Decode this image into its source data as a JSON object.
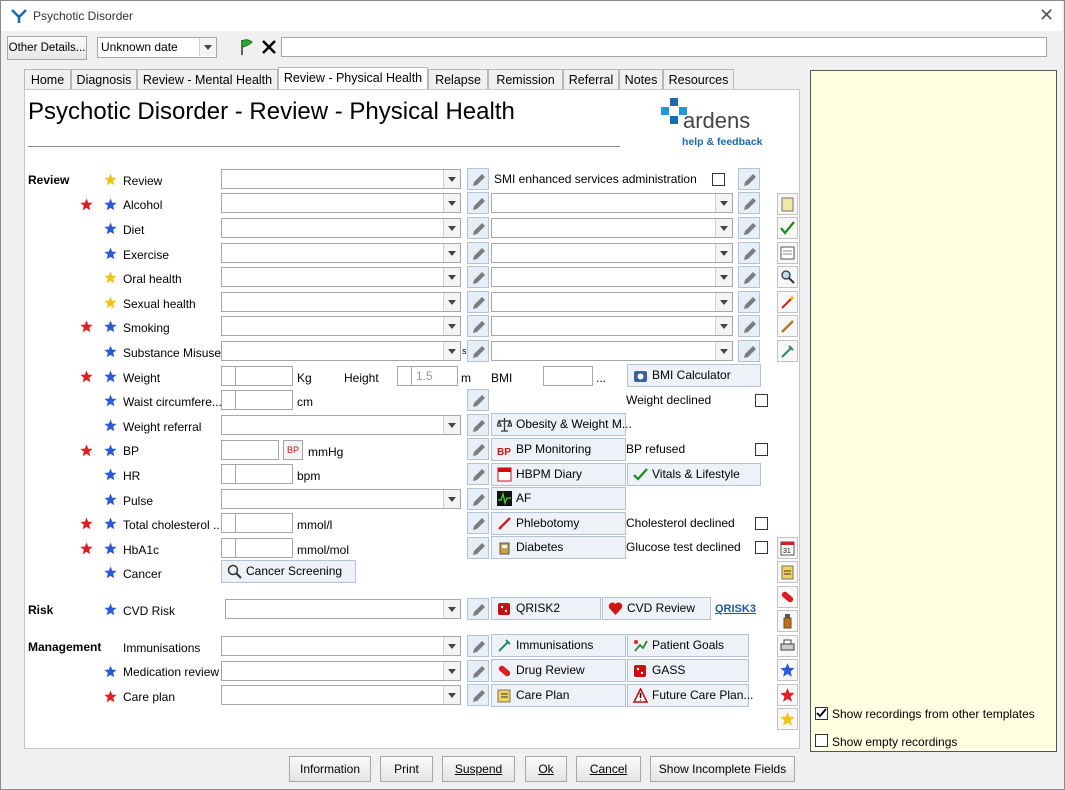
{
  "window": {
    "title": "Psychotic Disorder",
    "close": "✕"
  },
  "toolbar": {
    "other_details": "Other Details...",
    "date_value": "Unknown date",
    "text_value": ""
  },
  "tabs": [
    "Home",
    "Diagnosis",
    "Review - Mental Health",
    "Review - Physical Health",
    "Relapse",
    "Remission",
    "Referral",
    "Notes",
    "Resources"
  ],
  "active_tab": "Review - Physical Health",
  "page": {
    "title": "Psychotic Disorder - Review - Physical Health"
  },
  "brand": {
    "name": "ardens",
    "help": "help & feedback"
  },
  "sections": {
    "review": "Review",
    "risk": "Risk",
    "management": "Management"
  },
  "rows": {
    "review": "Review",
    "alcohol": "Alcohol",
    "diet": "Diet",
    "exercise": "Exercise",
    "oral_health": "Oral health",
    "sexual_health": "Sexual health",
    "smoking": "Smoking",
    "substance_misuse": "Substance Misuse",
    "weight": "Weight",
    "waist": "Waist circumfere...",
    "weight_referral": "Weight referral",
    "bp": "BP",
    "hr": "HR",
    "pulse": "Pulse",
    "total_cholesterol": "Total cholesterol ...",
    "hba1c": "HbA1c",
    "cancer": "Cancer",
    "cvd_risk": "CVD Risk",
    "immunisations": "Immunisations",
    "medication_review": "Medication review",
    "care_plan": "Care plan"
  },
  "units": {
    "kg": "Kg",
    "height": "Height",
    "m": "m",
    "bmi": "BMI",
    "ellipsis": "...",
    "cm": "cm",
    "mmhg": "mmHg",
    "bpm": "bpm",
    "mmol_l": "mmol/l",
    "mmol_mol": "mmol/mol",
    "bp_tag": "BP"
  },
  "height_value": "1.5",
  "notes": {
    "smi": "SMI enhanced services administration",
    "weight_declined": "Weight declined",
    "bp_refused": "BP refused",
    "chol_declined": "Cholesterol declined",
    "glucose_declined": "Glucose test declined",
    "s_marker": "s"
  },
  "buttons": {
    "bmi_calc": "BMI Calculator",
    "obesity": "Obesity & Weight M...",
    "bp_monitoring": "BP Monitoring",
    "hbpm": "HBPM Diary",
    "vitals": "Vitals & Lifestyle",
    "af": "AF",
    "phlebotomy": "Phlebotomy",
    "diabetes": "Diabetes",
    "cancer_screening": "Cancer Screening",
    "qrisk2": "QRISK2",
    "cvd_review": "CVD Review",
    "qrisk3": "QRISK3",
    "immunisations": "Immunisations",
    "patient_goals": "Patient Goals",
    "drug_review": "Drug Review",
    "gass": "GASS",
    "care_plan": "Care Plan",
    "future_care": "Future Care Plan..."
  },
  "side": {
    "show_other": "Show recordings from other templates",
    "show_empty": "Show empty recordings"
  },
  "bottom": {
    "information": "Information",
    "print": "Print",
    "suspend": "Suspend",
    "ok": "Ok",
    "cancel": "Cancel",
    "incomplete": "Show Incomplete Fields"
  },
  "colors": {
    "side_bg": "#ffffe1",
    "star_blue": "#2a5ad8",
    "star_red": "#e02020",
    "star_gold": "#f2c21a",
    "brand": "#1a6ab0"
  }
}
